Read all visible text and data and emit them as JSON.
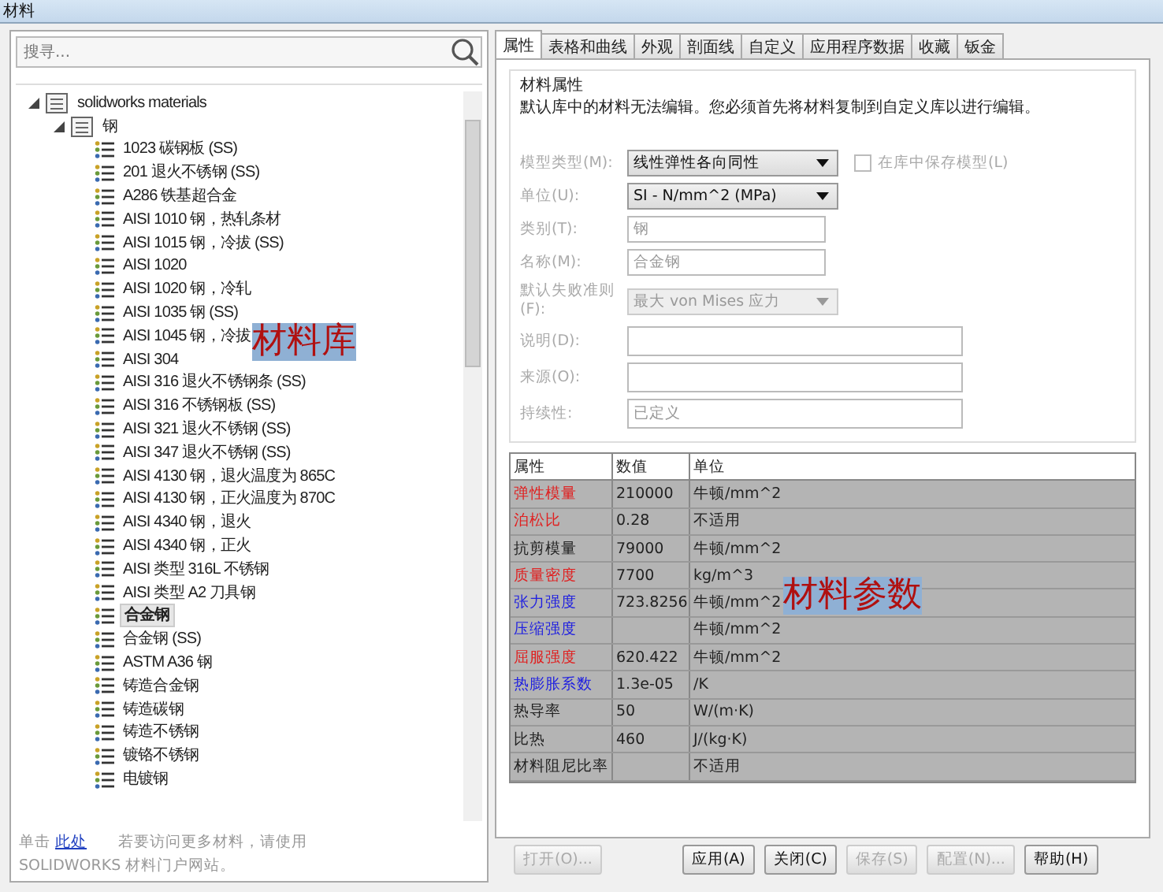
{
  "window": {
    "title": "材料"
  },
  "search": {
    "placeholder": "搜寻..."
  },
  "tree": [
    {
      "label": "solidworks materials",
      "kind": "library",
      "expanded": true,
      "children": [
        {
          "label": "钢",
          "kind": "category",
          "expanded": true,
          "children": [
            {
              "label": "1023 碳钢板 (SS)",
              "kind": "material",
              "selected": false
            },
            {
              "label": "201 退火不锈钢 (SS)",
              "kind": "material",
              "selected": false
            },
            {
              "label": "A286 铁基超合金",
              "kind": "material",
              "selected": false
            },
            {
              "label": "AISI 1010 钢，热轧条材",
              "kind": "material",
              "selected": false
            },
            {
              "label": "AISI 1015 钢，冷拔 (SS)",
              "kind": "material",
              "selected": false
            },
            {
              "label": "AISI 1020",
              "kind": "material",
              "selected": false
            },
            {
              "label": "AISI 1020 钢，冷轧",
              "kind": "material",
              "selected": false
            },
            {
              "label": "AISI 1035 钢 (SS)",
              "kind": "material",
              "selected": false
            },
            {
              "label": "AISI 1045 钢，冷拔",
              "kind": "material",
              "selected": false
            },
            {
              "label": "AISI 304",
              "kind": "material",
              "selected": false
            },
            {
              "label": "AISI 316 退火不锈钢条 (SS)",
              "kind": "material",
              "selected": false
            },
            {
              "label": "AISI 316 不锈钢板 (SS)",
              "kind": "material",
              "selected": false
            },
            {
              "label": "AISI 321 退火不锈钢 (SS)",
              "kind": "material",
              "selected": false
            },
            {
              "label": "AISI 347 退火不锈钢 (SS)",
              "kind": "material",
              "selected": false
            },
            {
              "label": "AISI 4130 钢，退火温度为 865C",
              "kind": "material",
              "selected": false
            },
            {
              "label": "AISI 4130 钢，正火温度为 870C",
              "kind": "material",
              "selected": false
            },
            {
              "label": "AISI 4340 钢，退火",
              "kind": "material",
              "selected": false
            },
            {
              "label": "AISI 4340 钢，正火",
              "kind": "material",
              "selected": false
            },
            {
              "label": "AISI 类型 316L 不锈钢",
              "kind": "material",
              "selected": false
            },
            {
              "label": "AISI 类型 A2 刀具钢",
              "kind": "material",
              "selected": false
            },
            {
              "label": "合金钢",
              "kind": "material",
              "selected": true
            },
            {
              "label": "合金钢 (SS)",
              "kind": "material",
              "selected": false
            },
            {
              "label": "ASTM A36 钢",
              "kind": "material",
              "selected": false
            },
            {
              "label": "铸造合金钢",
              "kind": "material",
              "selected": false
            },
            {
              "label": "铸造碳钢",
              "kind": "material",
              "selected": false
            },
            {
              "label": "铸造不锈钢",
              "kind": "material",
              "selected": false
            },
            {
              "label": "镀铬不锈钢",
              "kind": "material",
              "selected": false
            },
            {
              "label": "电镀钢",
              "kind": "material",
              "selected": false
            }
          ]
        }
      ]
    }
  ],
  "footer_note": {
    "before": "单击",
    "link": "此处",
    "after": "若要访问更多材料，请使用 SOLIDWORKS 材料门户网站。"
  },
  "tabs": [
    {
      "label": "属性",
      "selected": true
    },
    {
      "label": "表格和曲线",
      "selected": false
    },
    {
      "label": "外观",
      "selected": false
    },
    {
      "label": "剖面线",
      "selected": false
    },
    {
      "label": "自定义",
      "selected": false
    },
    {
      "label": "应用程序数据",
      "selected": false
    },
    {
      "label": "收藏",
      "selected": false
    },
    {
      "label": "钣金",
      "selected": false
    }
  ],
  "group": {
    "title": "材料属性",
    "note": "默认库中的材料无法编辑。您必须首先将材料复制到自定义库以进行编辑。"
  },
  "fields": [
    {
      "label": "模型类型(M):",
      "kind": "dropdown",
      "value": "线性弹性各向同性",
      "disabled": false
    },
    {
      "label": "单位(U):",
      "kind": "dropdown",
      "value": "SI - N/mm^2 (MPa)",
      "disabled": false
    },
    {
      "label": "类别(T):",
      "kind": "text",
      "value": "钢"
    },
    {
      "label": "名称(M):",
      "kind": "text",
      "value": "合金钢"
    },
    {
      "label": "默认失败准则(F):",
      "kind": "dropdown",
      "value": "最大 von Mises 应力",
      "disabled": true
    },
    {
      "label": "说明(D):",
      "kind": "wide_text"
    },
    {
      "label": "来源(O):",
      "kind": "wide_text"
    },
    {
      "label": "持续性:",
      "kind": "wide_text",
      "value": "已定义"
    }
  ],
  "checkbox": {
    "label": "在库中保存模型(L)",
    "checked": false,
    "disabled": true
  },
  "table": {
    "columns": [
      "属性",
      "数值",
      "单位"
    ],
    "rows": [
      {
        "property": "弹性模量",
        "color": "#e02020",
        "value": "210000",
        "unit": "牛顿/mm^2"
      },
      {
        "property": "泊松比",
        "color": "#e02020",
        "value": "0.28",
        "unit": "不适用"
      },
      {
        "property": "抗剪模量",
        "color": "#222222",
        "value": "79000",
        "unit": "牛顿/mm^2"
      },
      {
        "property": "质量密度",
        "color": "#e02020",
        "value": "7700",
        "unit": "kg/m^3"
      },
      {
        "property": "张力强度",
        "color": "#2020e0",
        "value": "723.8256",
        "unit": "牛顿/mm^2"
      },
      {
        "property": "压缩强度",
        "color": "#2020e0",
        "unit": "牛顿/mm^2"
      },
      {
        "property": "屈服强度",
        "color": "#e02020",
        "value": "620.422",
        "unit": "牛顿/mm^2"
      },
      {
        "property": "热膨胀系数",
        "color": "#2020e0",
        "value": "1.3e-05",
        "unit": "/K"
      },
      {
        "property": "热导率",
        "color": "#222222",
        "value": "50",
        "unit": "W/(m·K)"
      },
      {
        "property": "比热",
        "color": "#222222",
        "value": "460",
        "unit": "J/(kg·K)"
      },
      {
        "property": "材料阻尼比率",
        "color": "#222222",
        "unit": "不适用"
      }
    ]
  },
  "buttons": [
    {
      "label": "打开(O)...",
      "disabled": true
    },
    {
      "label": "应用(A)",
      "disabled": false
    },
    {
      "label": "关闭(C)",
      "disabled": false
    },
    {
      "label": "保存(S)",
      "disabled": true
    },
    {
      "label": "配置(N)...",
      "disabled": true
    },
    {
      "label": "帮助(H)",
      "disabled": false
    }
  ],
  "annotations": [
    {
      "text": "材料库"
    },
    {
      "text": "材料参数"
    }
  ]
}
